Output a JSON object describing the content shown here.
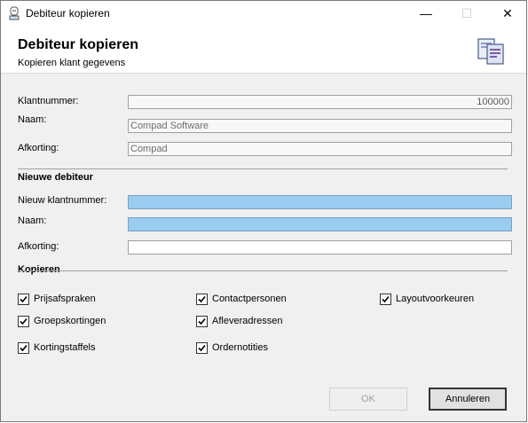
{
  "window": {
    "title": "Debiteur kopieren",
    "minimize": "—",
    "maximize": "☐",
    "close": "✕"
  },
  "header": {
    "title": "Debiteur kopieren",
    "subtitle": "Kopieren klant gegevens"
  },
  "current": {
    "klantnummer_label": "Klantnummer:",
    "klantnummer_value": "100000",
    "naam_label": "Naam:",
    "naam_value": "Compad Software",
    "afkorting_label": "Afkorting:",
    "afkorting_value": "Compad"
  },
  "nieuwe": {
    "section_title": "Nieuwe debiteur",
    "klantnummer_label": "Nieuw klantnummer:",
    "klantnummer_value": "",
    "naam_label": "Naam:",
    "naam_value": "",
    "afkorting_label": "Afkorting:",
    "afkorting_value": ""
  },
  "kopieren": {
    "section_title": "Kopieren",
    "options": [
      {
        "label": "Prijsafspraken",
        "checked": true
      },
      {
        "label": "Groepskortingen",
        "checked": true
      },
      {
        "label": "Kortingstaffels",
        "checked": true
      },
      {
        "label": "Contactpersonen",
        "checked": true
      },
      {
        "label": "Afleveradressen",
        "checked": true
      },
      {
        "label": "Ordernotities",
        "checked": true
      },
      {
        "label": "Layoutvoorkeuren",
        "checked": true
      }
    ]
  },
  "buttons": {
    "ok": "OK",
    "annuleren": "Annuleren"
  },
  "colors": {
    "new_field_highlight": "#99ccf0"
  }
}
